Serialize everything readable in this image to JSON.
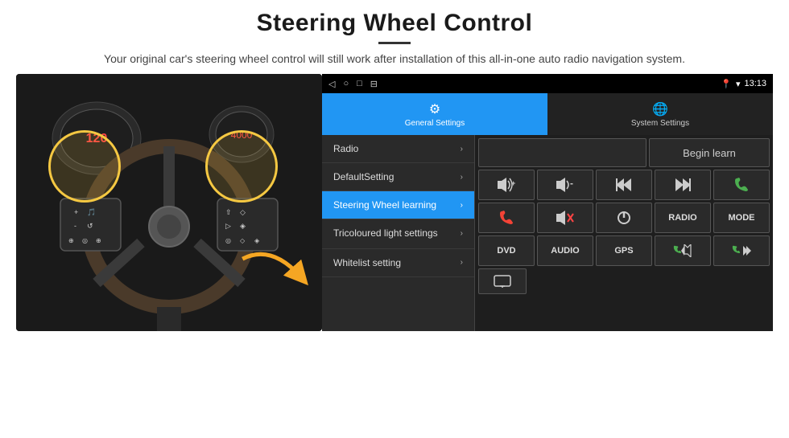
{
  "header": {
    "title": "Steering Wheel Control",
    "subtitle": "Your original car's steering wheel control will still work after installation of this all-in-one auto radio navigation system."
  },
  "statusBar": {
    "time": "13:13",
    "icons": [
      "◁",
      "○",
      "□",
      "⊟"
    ]
  },
  "tabs": [
    {
      "id": "general",
      "label": "General Settings",
      "icon": "⚙",
      "active": true
    },
    {
      "id": "system",
      "label": "System Settings",
      "icon": "🌐",
      "active": false
    }
  ],
  "menuItems": [
    {
      "id": "radio",
      "label": "Radio",
      "active": false
    },
    {
      "id": "default",
      "label": "DefaultSetting",
      "active": false
    },
    {
      "id": "steering",
      "label": "Steering Wheel learning",
      "active": true
    },
    {
      "id": "tricoloured",
      "label": "Tricoloured light settings",
      "active": false
    },
    {
      "id": "whitelist",
      "label": "Whitelist setting",
      "active": false
    }
  ],
  "controls": {
    "beginLearnLabel": "Begin learn",
    "row1": [
      {
        "icon": "🔊+",
        "type": "icon"
      },
      {
        "icon": "🔊-",
        "type": "icon"
      },
      {
        "icon": "⏮",
        "type": "icon"
      },
      {
        "icon": "⏭",
        "type": "icon"
      },
      {
        "icon": "📞",
        "type": "icon"
      }
    ],
    "row2": [
      {
        "icon": "📞↓",
        "type": "icon"
      },
      {
        "icon": "🔇",
        "type": "icon"
      },
      {
        "icon": "⏻",
        "type": "icon"
      },
      {
        "label": "RADIO",
        "type": "text"
      },
      {
        "label": "MODE",
        "type": "text"
      }
    ],
    "row3": [
      {
        "label": "DVD",
        "type": "text"
      },
      {
        "label": "AUDIO",
        "type": "text"
      },
      {
        "label": "GPS",
        "type": "text"
      },
      {
        "icon": "📞⏮",
        "type": "icon"
      },
      {
        "icon": "⏮📞",
        "type": "icon"
      }
    ],
    "row4": [
      {
        "icon": "🖥",
        "type": "icon"
      }
    ]
  }
}
